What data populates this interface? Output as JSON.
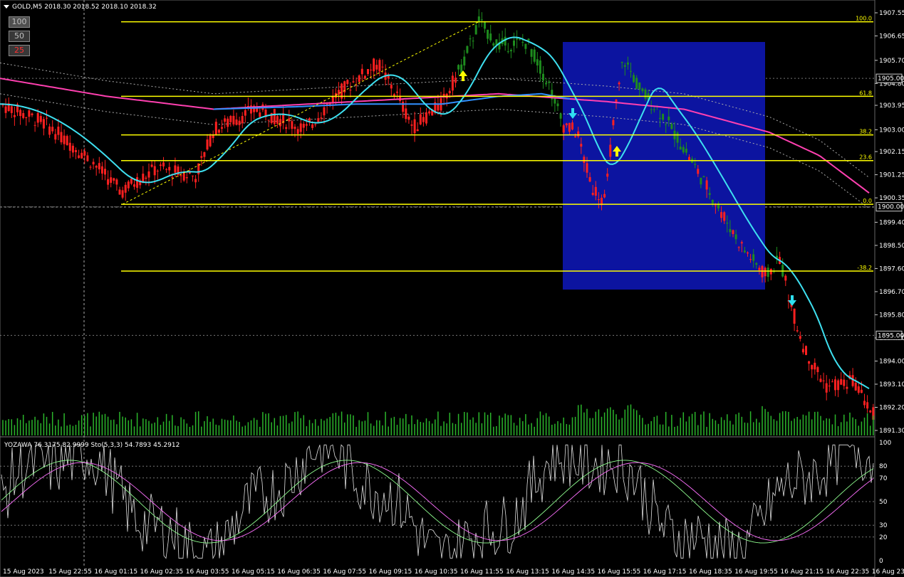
{
  "header": {
    "symbol_info": "GOLD,M5  2018.30 2018.52 2018.10 2018.32"
  },
  "zoom_buttons": [
    {
      "label": "100",
      "color": "#c0c0c0"
    },
    {
      "label": "50",
      "color": "#c0c0c0"
    },
    {
      "label": "25",
      "color": "#ff3030"
    }
  ],
  "price_axis": {
    "labels": [
      "1907.55",
      "1906.65",
      "1905.70",
      "1904.80",
      "1903.95",
      "1903.00",
      "1902.15",
      "1901.25",
      "1900.35",
      "1899.40",
      "1898.50",
      "1897.60",
      "1896.70",
      "1895.80",
      "1894.90",
      "1894.00",
      "1893.10",
      "1892.20",
      "1891.30"
    ],
    "marked": [
      {
        "label": "1905.00",
        "price": 1905.0
      },
      {
        "label": "1900.00",
        "price": 1900.0
      },
      {
        "label": "1895.00",
        "price": 1895.0
      }
    ]
  },
  "fib_levels": [
    {
      "label": "100.0",
      "price": 1907.2
    },
    {
      "label": "61.8",
      "price": 1904.3
    },
    {
      "label": "38.2",
      "price": 1902.8
    },
    {
      "label": "23.6",
      "price": 1901.8
    },
    {
      "label": "0.0",
      "price": 1900.1
    },
    {
      "label": "-38.2",
      "price": 1897.5
    }
  ],
  "time_axis": {
    "labels": [
      "15 Aug 2023",
      "15 Aug 22:55",
      "16 Aug 01:15",
      "16 Aug 02:35",
      "16 Aug 03:55",
      "16 Aug 05:15",
      "16 Aug 06:35",
      "16 Aug 07:55",
      "16 Aug 09:15",
      "16 Aug 10:35",
      "16 Aug 11:55",
      "16 Aug 13:15",
      "16 Aug 14:35",
      "16 Aug 15:55",
      "16 Aug 17:15",
      "16 Aug 18:35",
      "16 Aug 19:55",
      "16 Aug 21:15",
      "16 Aug 22:35",
      "16 Aug 23:55"
    ]
  },
  "indicator": {
    "label": "YOZAWA 76.3175 82.9999  Sto(5,3,3) 54.7893 45.2912",
    "levels": [
      "100",
      "80",
      "70",
      "50",
      "30",
      "20",
      "0"
    ]
  },
  "colors": {
    "bull": "#1e8c1e",
    "bear": "#ff2020",
    "fib": "#ffff00",
    "ma_fast": "#3ee0f0",
    "ma_mid": "#3090ff",
    "ma_slow": "#ff40b0",
    "box": "#0c14a0"
  }
}
